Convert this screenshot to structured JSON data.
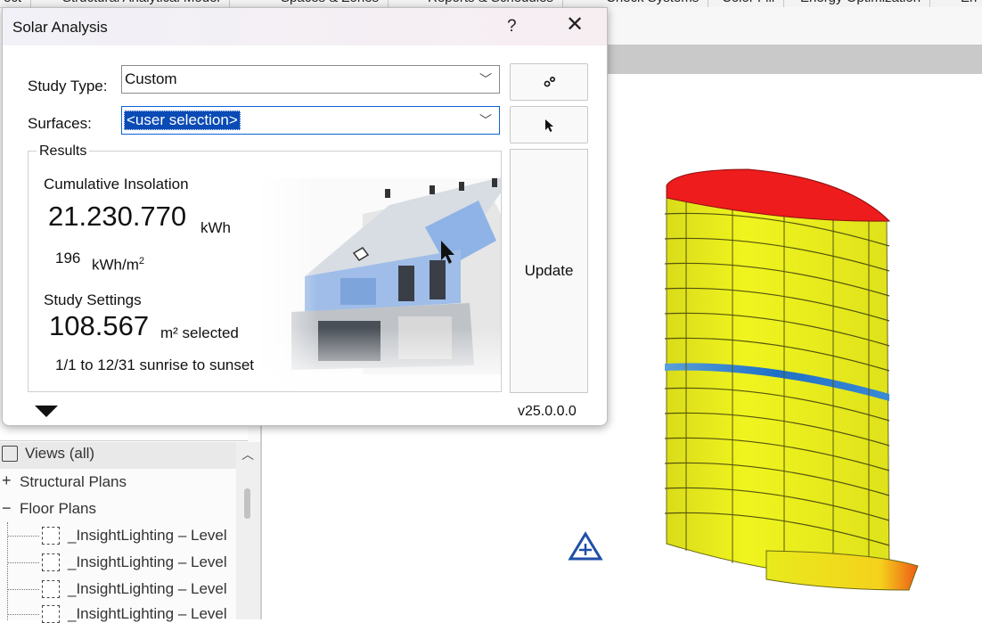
{
  "ribbon": {
    "tabs": [
      "ect",
      "Structural Analytical Model",
      "Spaces & Zones",
      "Reports & Schedules",
      "Check Systems",
      "Color Fill",
      "Energy Optimization",
      "En"
    ]
  },
  "dialog": {
    "title": "Solar Analysis",
    "help_label": "?",
    "close_label": "✕",
    "study_type_label": "Study Type:",
    "study_type_value": "Custom",
    "surfaces_label": "Surfaces:",
    "surfaces_value": "<user selection>",
    "settings_icon": "gear-settings-icon",
    "pick_icon": "cursor-pick-icon",
    "results": {
      "legend": "Results",
      "cumulative_label": "Cumulative Insolation",
      "cumulative_value": "21.230.770",
      "cumulative_unit": "kWh",
      "per_area_value": "196",
      "per_area_unit": "kWh/m",
      "per_area_sup": "2",
      "study_settings_label": "Study Settings",
      "area_value": "108.567",
      "area_unit": "m² selected",
      "period": "1/1 to 12/31 sunrise to sunset"
    },
    "update_label": "Update",
    "version": "v25.0.0.0"
  },
  "browser": {
    "header": "Views (all)",
    "items": [
      {
        "sign": "+",
        "label": "Structural Plans"
      },
      {
        "sign": "−",
        "label": "Floor Plans"
      }
    ],
    "leaves": [
      "_InsightLighting – Level",
      "_InsightLighting – Level",
      "_InsightLighting – Level",
      "_InsightLighting – Level"
    ]
  },
  "colors": {
    "selection": "#0a4bb5",
    "heat_high": "#ee1c1c",
    "heat_mid": "#eef21a",
    "heat_low": "#2b7fd6",
    "accent_blue": "#1f4fa8"
  }
}
